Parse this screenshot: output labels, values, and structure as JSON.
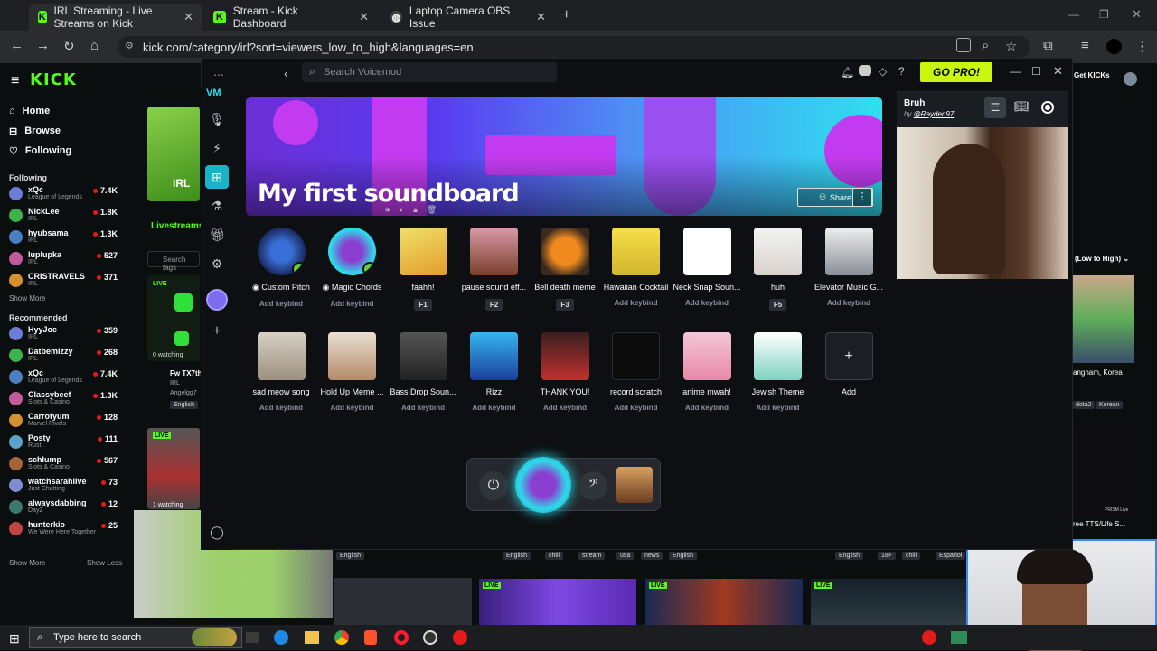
{
  "browser": {
    "tabs": [
      {
        "label": "IRL Streaming - Live Streams on Kick",
        "active": true
      },
      {
        "label": "Stream - Kick Dashboard",
        "active": false
      },
      {
        "label": "Laptop Camera OBS Issue",
        "active": false
      }
    ],
    "url": "kick.com/category/irl?sort=viewers_low_to_high&languages=en"
  },
  "kick": {
    "logo": "KICK",
    "nav": [
      "Home",
      "Browse",
      "Following"
    ],
    "following_title": "Following",
    "following": [
      {
        "name": "xQc",
        "cat": "League of Legends",
        "count": "7.4K"
      },
      {
        "name": "NickLee",
        "cat": "IRL",
        "count": "1.8K"
      },
      {
        "name": "hyubsama",
        "cat": "IRL",
        "count": "1.3K"
      },
      {
        "name": "luplupka",
        "cat": "IRL",
        "count": "527"
      },
      {
        "name": "CRISTRAVELS",
        "cat": "IRL",
        "count": "371"
      }
    ],
    "show_more": "Show More",
    "recommended_title": "Recommended",
    "recommended": [
      {
        "name": "HyyJoe",
        "cat": "IRL",
        "count": "359"
      },
      {
        "name": "Datbemizzy",
        "cat": "IRL",
        "count": "268"
      },
      {
        "name": "xQc",
        "cat": "League of Legends",
        "count": "7.4K"
      },
      {
        "name": "Classybeef",
        "cat": "Slots & Casino",
        "count": "1.3K"
      },
      {
        "name": "Carrotyum",
        "cat": "Marvel Rivals",
        "count": "128"
      },
      {
        "name": "Posty",
        "cat": "Rust",
        "count": "111"
      },
      {
        "name": "schlump",
        "cat": "Slots & Casino",
        "count": "567"
      },
      {
        "name": "watchsarahlive",
        "cat": "Just Chatting",
        "count": "73"
      },
      {
        "name": "alwaysdabbing",
        "cat": "DayZ",
        "count": "12"
      },
      {
        "name": "hunterkio",
        "cat": "We Were Here Together",
        "count": "25"
      }
    ],
    "show_more2": "Show More",
    "show_less": "Show Less",
    "irl_label": "IRL",
    "livestreams": "Livestreams",
    "search_tags": "Search tags",
    "live": "LIVE",
    "watching": "0 watching",
    "card_title": "Fw TX7th",
    "card_cat": "IRL",
    "card_user": "Angelgg7",
    "card_lang": "English",
    "watching2": "1 watching",
    "get_kicks": "Get KICKs",
    "sort": "(Low to High)",
    "right_caption": "angnam, Korea",
    "right_tags": [
      "dota2",
      "Korean"
    ],
    "right_caption2": "ree TTS/Life S...",
    "prism": "PRISM Live",
    "bottom_tags": [
      [
        "English"
      ],
      [
        "English",
        "chill",
        "stream",
        "usa",
        "news"
      ],
      [
        "English"
      ],
      [
        "English",
        "18+",
        "chill",
        "Español"
      ]
    ]
  },
  "voicemod": {
    "search_placeholder": "Search Voicemod",
    "gopro": "GO PRO!",
    "title": "My first soundboard",
    "share": "Share",
    "row1": [
      {
        "name": "Custom Pitch",
        "kb": "Add keybind",
        "key": false
      },
      {
        "name": "Magic Chords",
        "kb": "Add keybind",
        "key": false
      },
      {
        "name": "faahh!",
        "kb": "F1",
        "key": true
      },
      {
        "name": "pause sound eff...",
        "kb": "F2",
        "key": true
      },
      {
        "name": "Bell death meme",
        "kb": "F3",
        "key": true
      },
      {
        "name": "Hawaiian Cocktail",
        "kb": "Add keybind",
        "key": false
      },
      {
        "name": "Neck Snap Soun...",
        "kb": "Add keybind",
        "key": false
      },
      {
        "name": "huh",
        "kb": "F5",
        "key": true
      },
      {
        "name": "Elevator Music G...",
        "kb": "Add keybind",
        "key": false
      }
    ],
    "row2": [
      {
        "name": "sad meow song",
        "kb": "Add keybind"
      },
      {
        "name": "Hold Up Meme ...",
        "kb": "Add keybind"
      },
      {
        "name": "Bass Drop Soun...",
        "kb": "Add keybind"
      },
      {
        "name": "Rizz",
        "kb": "Add keybind"
      },
      {
        "name": "THANK YOU!",
        "kb": "Add keybind"
      },
      {
        "name": "record scratch",
        "kb": "Add keybind"
      },
      {
        "name": "anime mwah!",
        "kb": "Add keybind"
      },
      {
        "name": "Jewish Theme",
        "kb": "Add keybind"
      }
    ],
    "add_label": "Add",
    "preview_title": "Bruh",
    "preview_by": "by",
    "preview_author": "@Rayden97"
  },
  "taskbar": {
    "search_placeholder": "Type here to search"
  }
}
